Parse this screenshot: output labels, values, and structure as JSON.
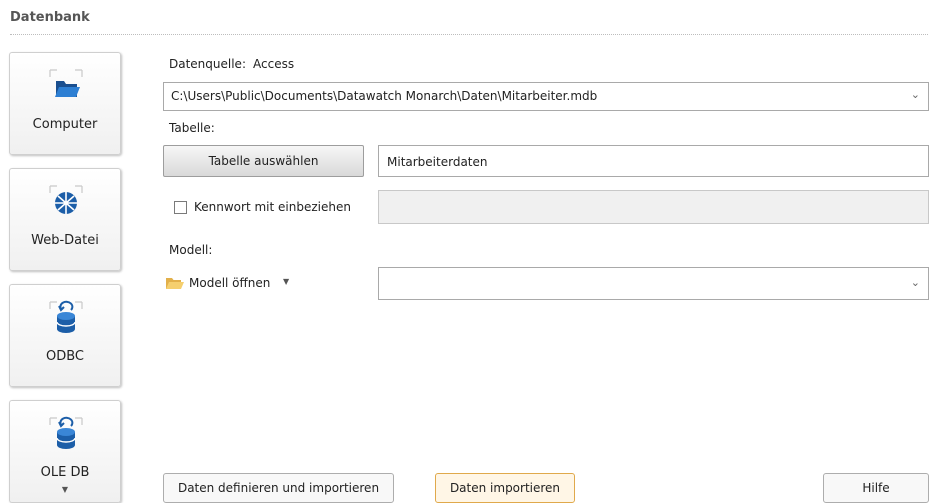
{
  "section": {
    "title": "Datenbank"
  },
  "sources": [
    {
      "label": "Computer",
      "icon": "open-folder-icon"
    },
    {
      "label": "Web-Datei",
      "icon": "globe-icon"
    },
    {
      "label": "ODBC",
      "icon": "database-icon"
    },
    {
      "label": "OLE DB",
      "icon": "database-icon"
    }
  ],
  "datasource": {
    "label": "Datenquelle:",
    "type": "Access",
    "path": "C:\\Users\\Public\\Documents\\Datawatch Monarch\\Daten\\Mitarbeiter.mdb"
  },
  "table": {
    "label": "Tabelle:",
    "select_button": "Tabelle auswählen",
    "value": "Mitarbeiterdaten"
  },
  "password": {
    "checkbox_label": "Kennwort mit einbeziehen",
    "checked": false,
    "value": ""
  },
  "model": {
    "label": "Modell:",
    "open_label": "Modell öffnen",
    "value": ""
  },
  "buttons": {
    "define_import": "Daten definieren und importieren",
    "import": "Daten importieren",
    "help": "Hilfe"
  },
  "colors": {
    "accent_border": "#e0a94b",
    "icon_blue": "#1c5ea8"
  }
}
